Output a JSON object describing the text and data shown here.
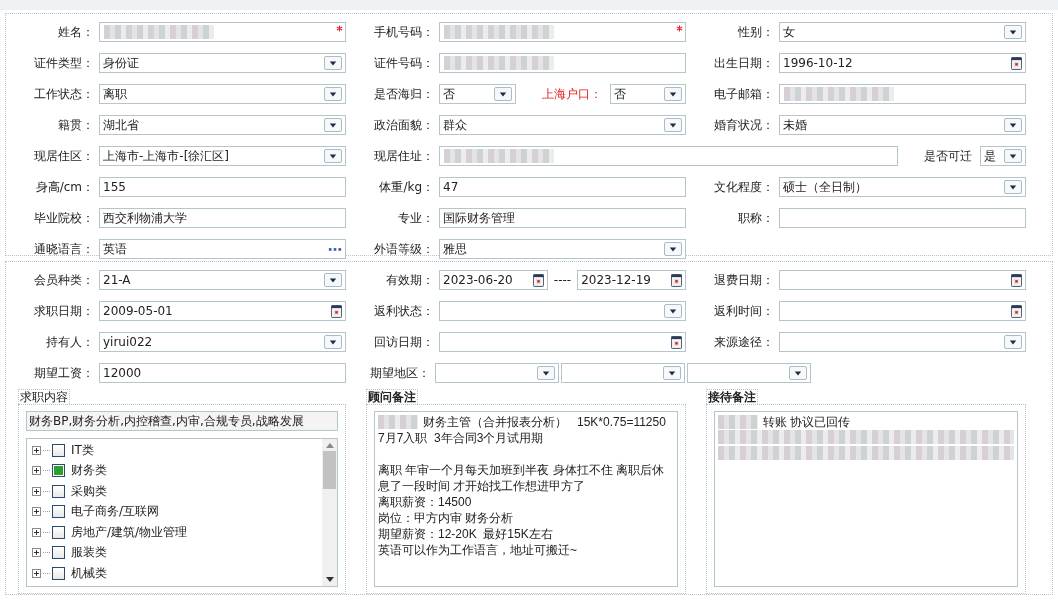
{
  "sections": [
    {
      "cells": [
        {
          "label": "姓名：",
          "fields": [
            {
              "kind": "redacted",
              "required": true
            }
          ]
        },
        {
          "label": "手机号码：",
          "fields": [
            {
              "kind": "redacted",
              "required": true
            }
          ]
        },
        {
          "label": "性别：",
          "fields": [
            {
              "kind": "select",
              "value": "女"
            }
          ]
        },
        {
          "label": "证件类型：",
          "fields": [
            {
              "kind": "select",
              "value": "身份证"
            }
          ]
        },
        {
          "label": "证件号码：",
          "fields": [
            {
              "kind": "redacted"
            }
          ]
        },
        {
          "label": "出生日期：",
          "fields": [
            {
              "kind": "date",
              "value": "1996-10-12"
            }
          ]
        },
        {
          "label": "工作状态：",
          "fields": [
            {
              "kind": "select",
              "value": "离职"
            }
          ]
        },
        {
          "label": "是否海归：",
          "fields": [
            {
              "kind": "select",
              "value": "否"
            },
            {
              "kind": "label",
              "text": "上海户口：",
              "alert": true
            },
            {
              "kind": "select",
              "value": "否"
            }
          ]
        },
        {
          "label": "电子邮箱：",
          "fields": [
            {
              "kind": "redacted"
            }
          ]
        },
        {
          "label": "籍贯：",
          "fields": [
            {
              "kind": "select",
              "value": "湖北省"
            }
          ]
        },
        {
          "label": "政治面貌：",
          "fields": [
            {
              "kind": "select",
              "value": "群众"
            }
          ]
        },
        {
          "label": "婚育状况：",
          "fields": [
            {
              "kind": "select",
              "value": "未婚"
            }
          ]
        },
        {
          "label": "现居住区：",
          "fields": [
            {
              "kind": "select",
              "value": "上海市-上海市-[徐汇区]"
            }
          ]
        },
        {
          "label": "现居住址：",
          "kind": "address",
          "fields": [
            {
              "kind": "redacted"
            },
            {
              "kind": "label",
              "text": "是否可迁",
              "alert": false
            },
            {
              "kind": "select",
              "value": "是"
            }
          ]
        },
        {
          "label": "身高/cm：",
          "fields": [
            {
              "kind": "text",
              "value": "155"
            }
          ]
        },
        {
          "label": "体重/kg：",
          "fields": [
            {
              "kind": "text",
              "value": "47"
            }
          ]
        },
        {
          "label": "文化程度：",
          "fields": [
            {
              "kind": "select",
              "value": "硕士（全日制）"
            }
          ]
        },
        {
          "label": "毕业院校：",
          "fields": [
            {
              "kind": "text",
              "value": "西交利物浦大学"
            }
          ]
        },
        {
          "label": "专业：",
          "fields": [
            {
              "kind": "text",
              "value": "国际财务管理"
            }
          ]
        },
        {
          "label": "职称：",
          "fields": [
            {
              "kind": "text"
            }
          ]
        },
        {
          "label": "通晓语言：",
          "fields": [
            {
              "kind": "more",
              "value": "英语"
            }
          ]
        },
        {
          "label": "外语等级：",
          "fields": [
            {
              "kind": "select",
              "value": "雅思"
            }
          ]
        }
      ]
    },
    {
      "cells": [
        {
          "label": "会员种类：",
          "fields": [
            {
              "kind": "select",
              "value": "21-A"
            }
          ]
        },
        {
          "label": "有效期：",
          "fields": [
            {
              "kind": "date",
              "value": "2023-06-20"
            },
            {
              "kind": "separator",
              "text": "----"
            },
            {
              "kind": "date",
              "value": "2023-12-19"
            }
          ]
        },
        {
          "label": "退费日期：",
          "fields": [
            {
              "kind": "date"
            }
          ]
        },
        {
          "label": "求职日期：",
          "fields": [
            {
              "kind": "date",
              "value": "2009-05-01"
            }
          ]
        },
        {
          "label": "返利状态：",
          "fields": [
            {
              "kind": "select"
            }
          ]
        },
        {
          "label": "返利时间：",
          "fields": [
            {
              "kind": "date"
            }
          ]
        },
        {
          "label": "持有人：",
          "fields": [
            {
              "kind": "select",
              "value": "yirui022"
            }
          ]
        },
        {
          "label": "回访日期：",
          "fields": [
            {
              "kind": "date"
            }
          ]
        },
        {
          "label": "来源途径：",
          "fields": [
            {
              "kind": "select"
            }
          ]
        },
        {
          "label": "期望工资：",
          "fields": [
            {
              "kind": "text",
              "value": "12000"
            }
          ]
        },
        {
          "label": "期望地区：",
          "kind": "region",
          "fields": [
            {
              "kind": "select"
            },
            {
              "kind": "select"
            },
            {
              "kind": "select"
            }
          ]
        }
      ]
    }
  ],
  "job_intent": {
    "title": "求职内容",
    "summary": "财务BP,财务分析,内控稽查,内审,合规专员,战略发展",
    "tree": [
      {
        "label": "IT类",
        "checked": false,
        "expanded": false
      },
      {
        "label": "财务类",
        "checked": true,
        "expanded": false
      },
      {
        "label": "采购类",
        "checked": false,
        "expanded": false
      },
      {
        "label": "电子商务/互联网",
        "checked": false,
        "expanded": false
      },
      {
        "label": "房地产/建筑/物业管理",
        "checked": false,
        "expanded": false
      },
      {
        "label": "服装类",
        "checked": false,
        "expanded": false
      },
      {
        "label": "机械类",
        "checked": false,
        "expanded": false
      }
    ]
  },
  "notes": [
    {
      "title": "顾问备注",
      "lines": [
        {
          "kind": "text",
          "masked_prefix": true,
          "text": "财务主管（合并报表分析）   15K*0.75=11250"
        },
        {
          "kind": "text",
          "text": "7月7入职  3年合同3个月试用期"
        },
        {
          "kind": "blank"
        },
        {
          "kind": "text",
          "text": "离职 年审一个月每天加班到半夜 身体扛不住 离职后休息了一段时间 才开始找工作想进甲方了"
        },
        {
          "kind": "text",
          "text": "离职薪资：14500"
        },
        {
          "kind": "text",
          "text": "岗位：甲方内审 财务分析"
        },
        {
          "kind": "text",
          "text": "期望薪资：12-20K  最好15K左右"
        },
        {
          "kind": "text",
          "text": "英语可以作为工作语言，地址可搬迁~"
        }
      ]
    },
    {
      "title": "接待备注",
      "lines": [
        {
          "kind": "text",
          "masked_prefix": true,
          "text": "转账 协议已回传"
        },
        {
          "kind": "redacted"
        },
        {
          "kind": "redacted"
        }
      ]
    }
  ]
}
